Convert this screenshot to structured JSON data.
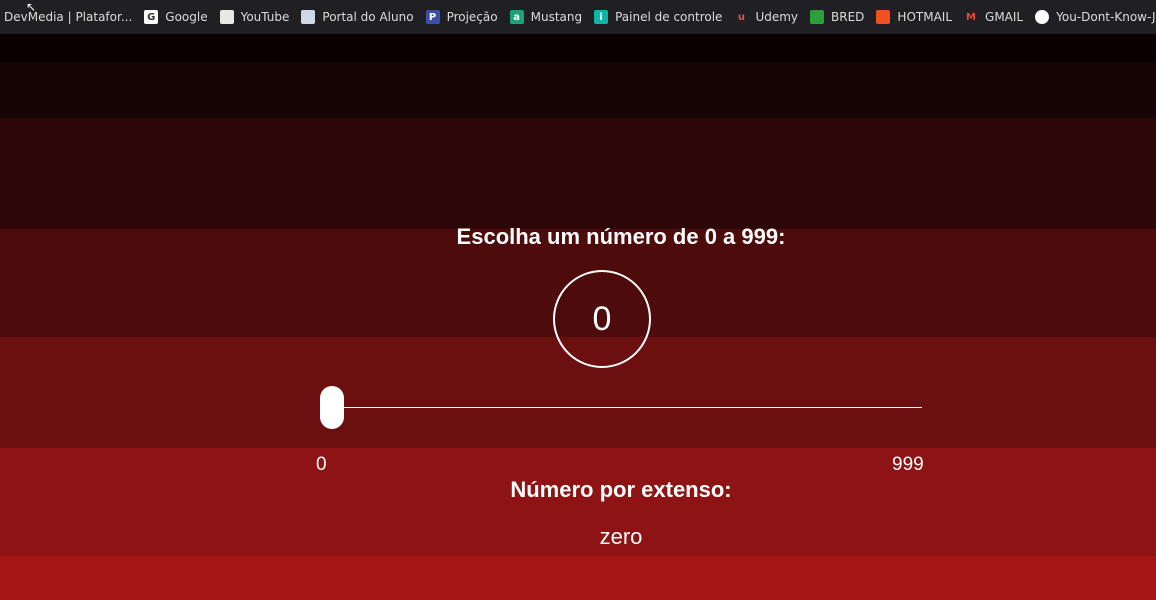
{
  "bookmarks": [
    {
      "label": "DevMedia | Platafor...",
      "icon": "devmedia-icon",
      "color": "#2b2b2b",
      "glyph": ""
    },
    {
      "label": "Google",
      "icon": "google-icon",
      "color": "#ffffff",
      "glyph": "G"
    },
    {
      "label": "YouTube",
      "icon": "page-icon",
      "color": "#e8e8e8",
      "glyph": ""
    },
    {
      "label": "Portal do Aluno",
      "icon": "document-icon",
      "color": "#cfd8e6",
      "glyph": ""
    },
    {
      "label": "Projeção",
      "icon": "projecao-icon",
      "color": "#3b4fa8",
      "glyph": "P"
    },
    {
      "label": "Mustang",
      "icon": "mustang-icon",
      "color": "#1aa37a",
      "glyph": "a"
    },
    {
      "label": "Painel de controle",
      "icon": "info-icon",
      "color": "#12b3a8",
      "glyph": "i"
    },
    {
      "label": "Udemy",
      "icon": "udemy-icon",
      "color": "#1f1f24",
      "glyph": "u"
    },
    {
      "label": "BRED",
      "icon": "flag-icon",
      "color": "#2c9e3a",
      "glyph": ""
    },
    {
      "label": "HOTMAIL",
      "icon": "microsoft-icon",
      "color": "#f25022",
      "glyph": ""
    },
    {
      "label": "GMAIL",
      "icon": "gmail-icon",
      "color": "#1f1f24",
      "glyph": "M"
    },
    {
      "label": "You-Dont-Know-JS/...",
      "icon": "github-icon",
      "color": "#ffffff",
      "glyph": ""
    }
  ],
  "page": {
    "title": "Escolha um número de 0 a 999:",
    "value": "0",
    "slider": {
      "min": "0",
      "max": "999",
      "value": 0
    },
    "extenso_title": "Número por extenso:",
    "extenso_value": "zero"
  },
  "stripe_colors": [
    "#0b0000",
    "#170405",
    "#2d0707",
    "#4d0b0b",
    "#6b0f10",
    "#8d1314",
    "#a61616"
  ]
}
